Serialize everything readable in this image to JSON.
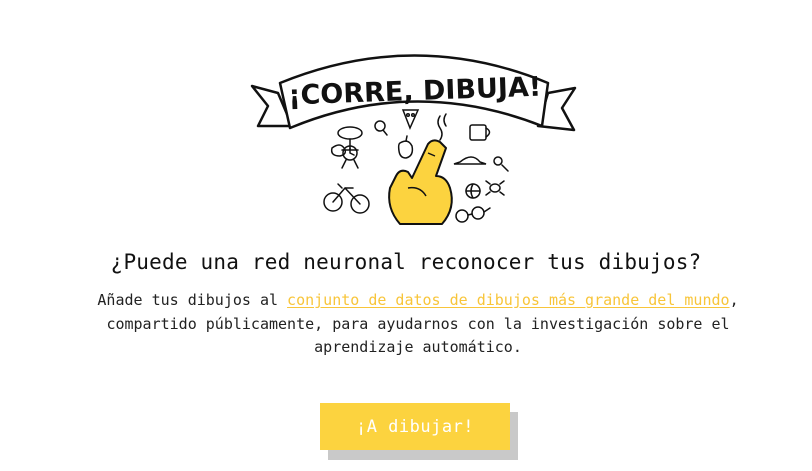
{
  "logo": {
    "text": "¡CORRE, DIBUJA!"
  },
  "headline": "¿Puede una red neuronal reconocer tus dibujos?",
  "description": {
    "before": "Añade tus dibujos al ",
    "link": "conjunto de datos de dibujos más grande del mundo",
    "after": ", compartido públicamente, para ayudarnos con la investigación sobre el aprendizaje automático."
  },
  "cta": {
    "label": "¡A dibujar!"
  },
  "colors": {
    "accent": "#fcd33f",
    "link": "#f8c53a",
    "button_shadow": "#c9c9c9",
    "button_text": "#ffffff"
  }
}
